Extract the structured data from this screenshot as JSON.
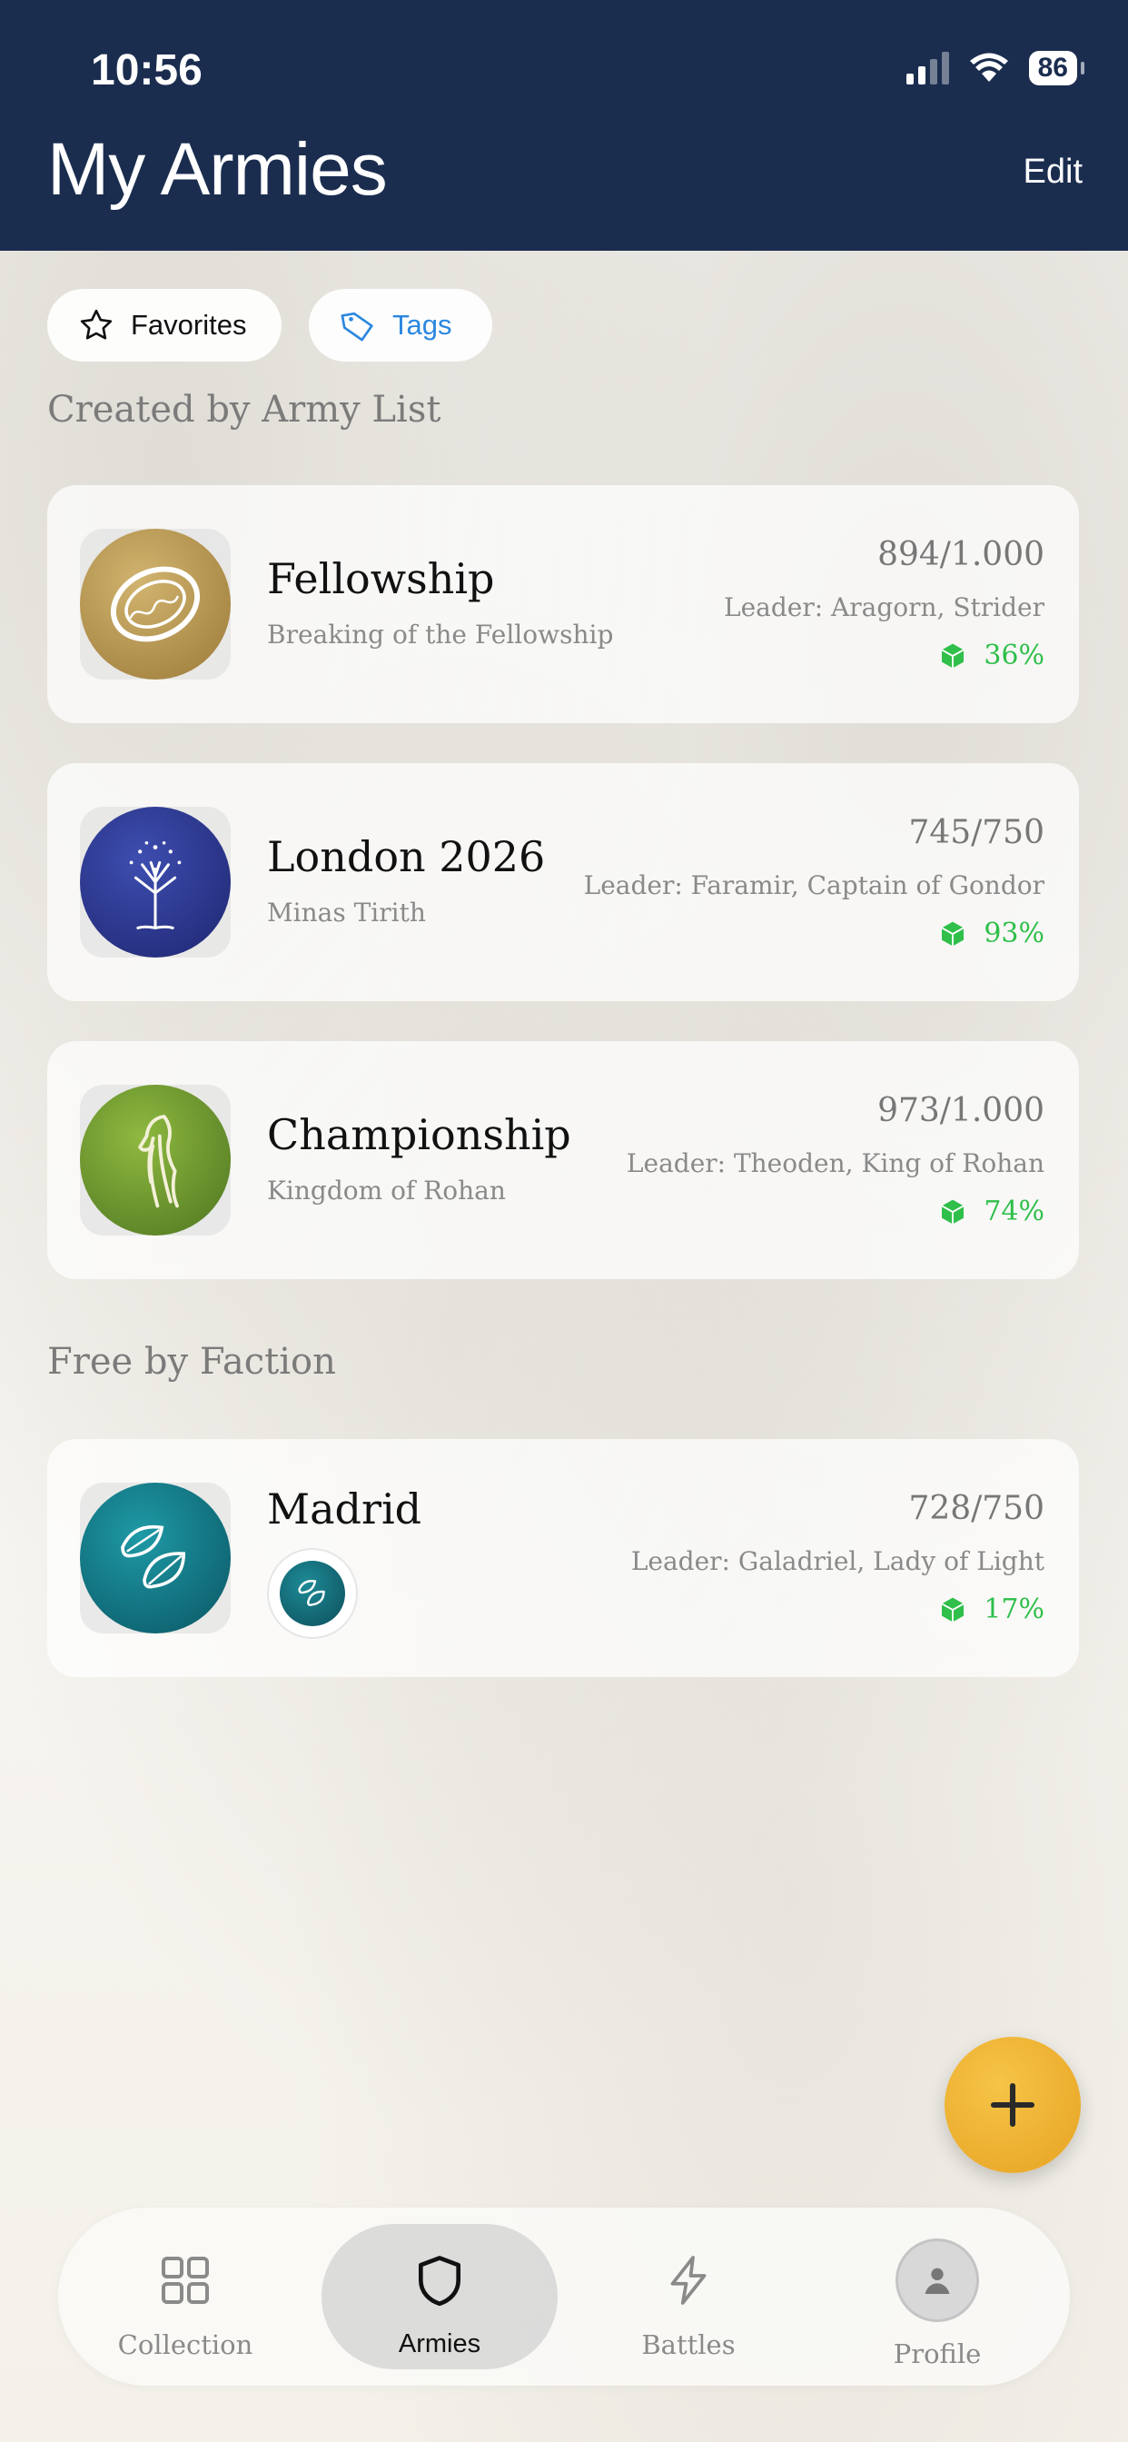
{
  "status_bar": {
    "time": "10:56",
    "battery": "86"
  },
  "header": {
    "title": "My Armies",
    "edit_label": "Edit"
  },
  "filters": {
    "favorites_label": "Favorites",
    "tags_label": "Tags"
  },
  "sections": {
    "army_list_title": "Created by Army List",
    "faction_title": "Free by Faction"
  },
  "armies": [
    {
      "name": "Fellowship",
      "subtitle": "Breaking of the Fellowship",
      "points": "894/1.000",
      "leader": "Leader: Aragorn, Strider",
      "percent": "36%",
      "emblem": "one-ring-icon",
      "color": "#b8944f"
    },
    {
      "name": "London 2026",
      "subtitle": "Minas Tirith",
      "points": "745/750",
      "leader": "Leader: Faramir, Captain of Gondor",
      "percent": "93%",
      "emblem": "white-tree-icon",
      "color": "#2f3a8f"
    },
    {
      "name": "Championship",
      "subtitle": "Kingdom of Rohan",
      "points": "973/1.000",
      "leader": "Leader: Theoden, King of Rohan",
      "percent": "74%",
      "emblem": "horse-icon",
      "color": "#6f9a2e"
    }
  ],
  "faction_armies": [
    {
      "name": "Madrid",
      "points": "728/750",
      "leader": "Leader: Galadriel, Lady of Light",
      "percent": "17%",
      "emblem": "leaf-icon",
      "color": "#137a85"
    }
  ],
  "tabs": [
    {
      "label": "Collection",
      "icon": "grid-icon"
    },
    {
      "label": "Armies",
      "icon": "shield-icon",
      "active": true
    },
    {
      "label": "Battles",
      "icon": "lightning-icon"
    },
    {
      "label": "Profile",
      "icon": "person-icon"
    }
  ],
  "colors": {
    "header": "#1b2d4f",
    "accent": "#2b87e0",
    "success": "#2fbf4a",
    "fab": "#f0b53a"
  }
}
